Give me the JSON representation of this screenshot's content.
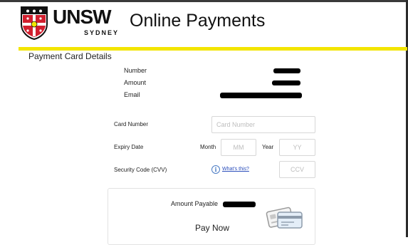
{
  "header": {
    "logo_word": "UNSW",
    "logo_sub": "SYDNEY",
    "app_title": "Online Payments"
  },
  "section": {
    "title": "Payment Card Details"
  },
  "info": {
    "number_label": "Number",
    "amount_label": "Amount",
    "email_label": "Email"
  },
  "form": {
    "card_number_label": "Card Number",
    "card_number_placeholder": "Card Number",
    "expiry_label": "Expiry Date",
    "month_label": "Month",
    "month_placeholder": "MM",
    "year_label": "Year",
    "year_placeholder": "YY",
    "security_label": "Security Code (CVV)",
    "whats_this": "What's this?",
    "ccv_placeholder": "CCV"
  },
  "payment": {
    "amount_payable_label": "Amount Payable",
    "pay_button": "Pay Now"
  },
  "colors": {
    "accent_yellow": "#f3e500",
    "link_blue": "#2a4dbb",
    "crest_red": "#d11f2e"
  }
}
